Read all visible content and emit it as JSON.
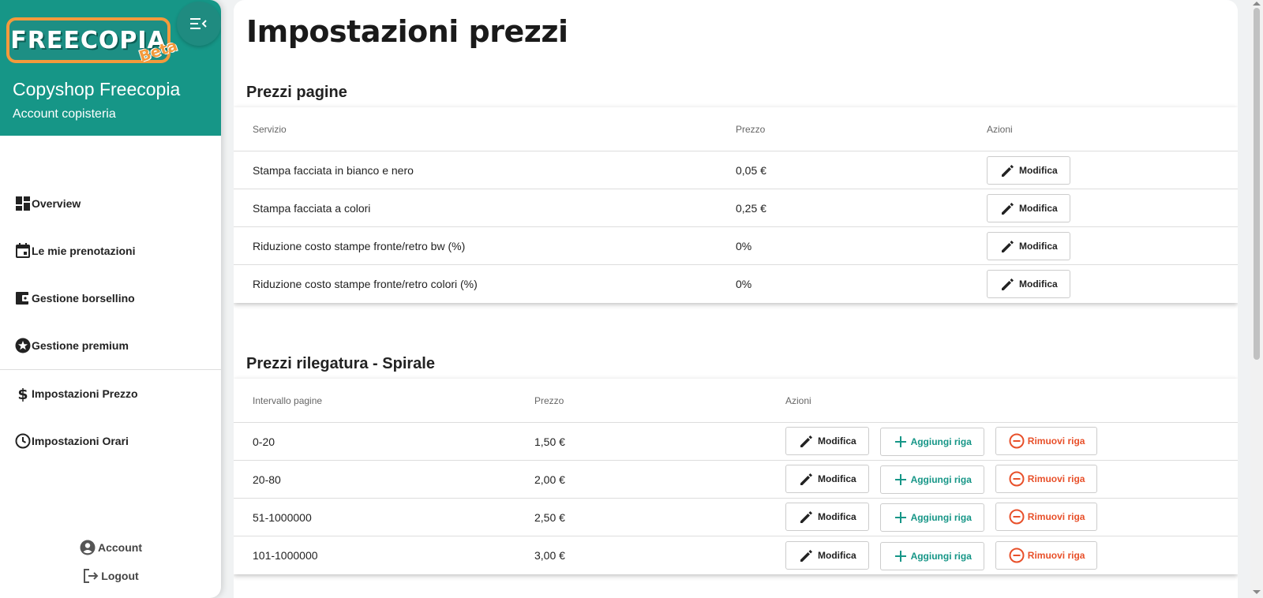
{
  "brand": {
    "logo_text": "FREECOPIA",
    "logo_badge": "Beta",
    "shop_name": "Copyshop Freecopia",
    "account_type": "Account copisteria",
    "accent_color": "#169687",
    "logo_border_color": "#f39a3c"
  },
  "nav": {
    "items": [
      {
        "label": "Overview",
        "icon": "dashboard-icon"
      },
      {
        "label": "Le mie prenotazioni",
        "icon": "calendar-icon"
      },
      {
        "label": "Gestione borsellino",
        "icon": "wallet-icon"
      },
      {
        "label": "Gestione premium",
        "icon": "star-icon"
      },
      {
        "label": "Impostazioni Prezzo",
        "icon": "dollar-icon"
      },
      {
        "label": "Impostazioni Orari",
        "icon": "clock-icon"
      }
    ],
    "account_label": "Account",
    "logout_label": "Logout"
  },
  "page": {
    "title": "Impostazioni prezzi"
  },
  "pages_prices": {
    "title": "Prezzi pagine",
    "headers": {
      "service": "Servizio",
      "price": "Prezzo",
      "actions": "Azioni"
    },
    "rows": [
      {
        "service": "Stampa facciata in bianco e nero",
        "price": "0,05 €"
      },
      {
        "service": "Stampa facciata a colori",
        "price": "0,25 €"
      },
      {
        "service": "Riduzione costo stampe fronte/retro bw (%)",
        "price": "0%"
      },
      {
        "service": "Riduzione costo stampe fronte/retro colori (%)",
        "price": "0%"
      }
    ]
  },
  "binding_prices": {
    "title": "Prezzi rilegatura - Spirale",
    "headers": {
      "range": "Intervallo pagine",
      "price": "Prezzo",
      "actions": "Azioni"
    },
    "rows": [
      {
        "range": "0-20",
        "price": "1,50 €"
      },
      {
        "range": "20-80",
        "price": "2,00 €"
      },
      {
        "range": "51-1000000",
        "price": "2,50 €"
      },
      {
        "range": "101-1000000",
        "price": "3,00 €"
      }
    ]
  },
  "buttons": {
    "edit": "Modifica",
    "add_row": "Aggiungi riga",
    "remove_row": "Rimuovi riga",
    "add_color": "#169687",
    "remove_color": "#e8502a"
  }
}
